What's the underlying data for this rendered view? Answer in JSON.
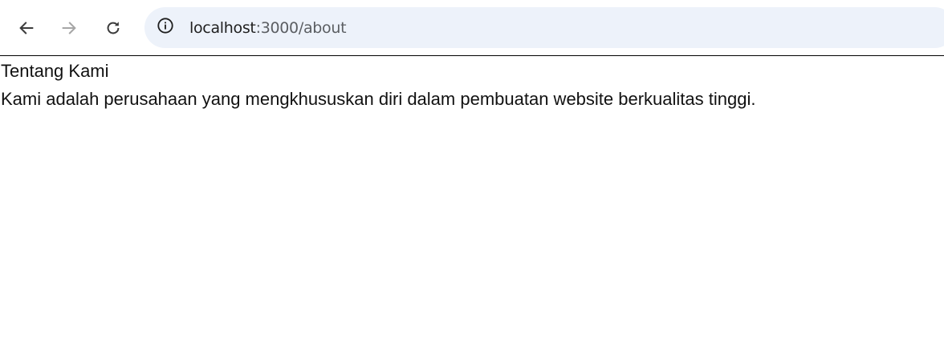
{
  "browser": {
    "url_host": "localhost",
    "url_path": ":3000/about",
    "icons": {
      "back": "arrow-left-icon",
      "forward": "arrow-right-icon",
      "reload": "reload-icon",
      "site_info": "info-circle-icon"
    },
    "colors": {
      "omnibox_bg": "#edf2fa",
      "forward_disabled": "#a6a6a6"
    }
  },
  "page": {
    "heading": "Tentang Kami",
    "description": "Kami adalah perusahaan yang mengkhususkan diri dalam pembuatan website berkualitas tinggi."
  }
}
